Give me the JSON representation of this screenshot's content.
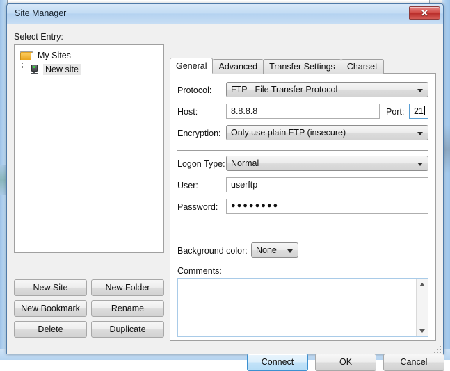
{
  "window": {
    "title": "Site Manager",
    "close_label": "✕"
  },
  "left_panel": {
    "select_entry_label": "Select Entry:",
    "tree": {
      "root": {
        "label": "My Sites",
        "icon": "folder-icon"
      },
      "children": [
        {
          "label": "New site",
          "icon": "server-icon",
          "selected": true
        }
      ]
    },
    "buttons": [
      "New Site",
      "New Folder",
      "New Bookmark",
      "Rename",
      "Delete",
      "Duplicate"
    ]
  },
  "right_panel": {
    "tabs": [
      {
        "label": "General",
        "active": true
      },
      {
        "label": "Advanced",
        "active": false
      },
      {
        "label": "Transfer Settings",
        "active": false
      },
      {
        "label": "Charset",
        "active": false
      }
    ],
    "general": {
      "protocol": {
        "label": "Protocol:",
        "value": "FTP - File Transfer Protocol"
      },
      "host": {
        "label": "Host:",
        "value": "8.8.8.8"
      },
      "port": {
        "label": "Port:",
        "value": "21",
        "focused": true
      },
      "encryption": {
        "label": "Encryption:",
        "value": "Only use plain FTP (insecure)"
      },
      "logon_type": {
        "label": "Logon Type:",
        "value": "Normal"
      },
      "user": {
        "label": "User:",
        "value": "userftp"
      },
      "password": {
        "label": "Password:",
        "value": "●●●●●●●●"
      },
      "background_color": {
        "label": "Background color:",
        "value": "None"
      },
      "comments": {
        "label": "Comments:",
        "value": ""
      }
    }
  },
  "bottom_buttons": [
    {
      "label": "Connect",
      "default": true
    },
    {
      "label": "OK",
      "default": false
    },
    {
      "label": "Cancel",
      "default": false
    }
  ],
  "colors": {
    "titlebar": "#b4d2f0",
    "close_button": "#b92e2b",
    "default_button_border": "#3c90d0",
    "focus_border": "#5a9fd4",
    "dialog_bg": "#f0f0f0"
  }
}
